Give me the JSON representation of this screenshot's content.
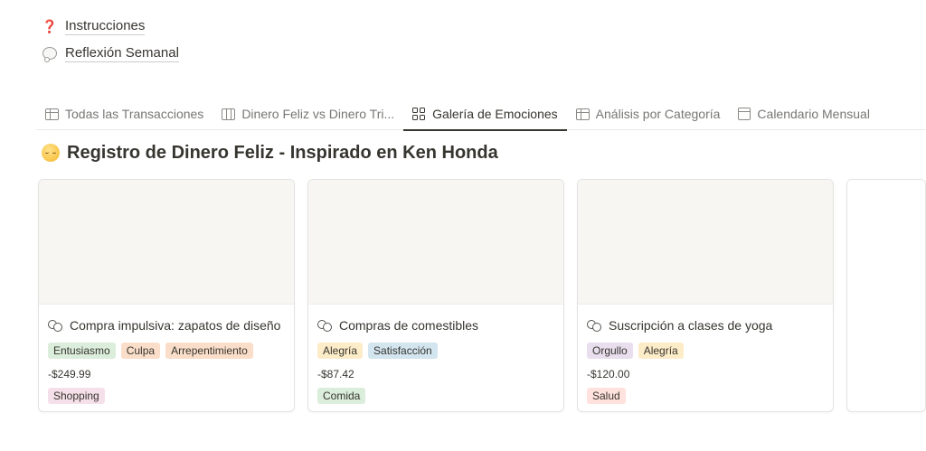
{
  "links": [
    {
      "emoji": "❓",
      "label": "Instrucciones"
    },
    {
      "emoji": "💭",
      "label": "Reflexión Semanal"
    }
  ],
  "tabs": [
    {
      "icon": "table-icon",
      "label": "Todas las Transacciones"
    },
    {
      "icon": "board-icon",
      "label": "Dinero Feliz vs Dinero Tri..."
    },
    {
      "icon": "gallery-icon",
      "label": "Galería de Emociones",
      "active": true
    },
    {
      "icon": "table-icon",
      "label": "Análisis por Categoría"
    },
    {
      "icon": "calendar-icon",
      "label": "Calendario Mensual"
    }
  ],
  "title": {
    "emoji": "relieved-face",
    "text": "Registro de Dinero Feliz - Inspirado en Ken Honda"
  },
  "cards": [
    {
      "icon": "coins-icon",
      "title": "Compra impulsiva: zapatos de diseño",
      "emotions": [
        {
          "label": "Entusiasmo",
          "color": "#dbeddb"
        },
        {
          "label": "Culpa",
          "color": "#fadec9"
        },
        {
          "label": "Arrepentimiento",
          "color": "#fadec9"
        }
      ],
      "amount": "-$249.99",
      "category": {
        "label": "Shopping",
        "color": "#f5e0e9"
      }
    },
    {
      "icon": "coins-icon",
      "title": "Compras de comestibles",
      "emotions": [
        {
          "label": "Alegría",
          "color": "#fdecc8"
        },
        {
          "label": "Satisfacción",
          "color": "#d3e5ef"
        }
      ],
      "amount": "-$87.42",
      "category": {
        "label": "Comida",
        "color": "#dbeddb"
      }
    },
    {
      "icon": "coins-icon",
      "title": "Suscripción a clases de yoga",
      "emotions": [
        {
          "label": "Orgullo",
          "color": "#e8deee"
        },
        {
          "label": "Alegría",
          "color": "#fdecc8"
        }
      ],
      "amount": "-$120.00",
      "category": {
        "label": "Salud",
        "color": "#ffe2dd"
      }
    }
  ]
}
